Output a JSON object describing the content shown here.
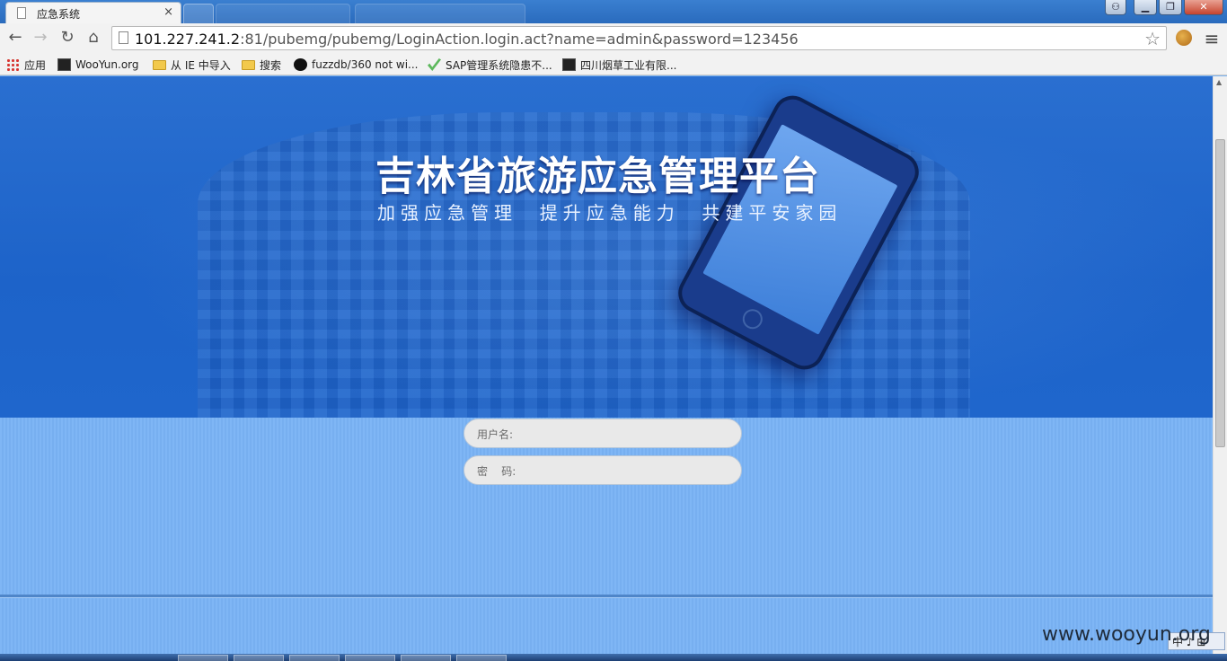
{
  "browser": {
    "active_tab": {
      "title": "应急系统",
      "close": "×"
    },
    "window_buttons": {
      "minimize": "▁",
      "maximize": "❐",
      "close": "✕"
    },
    "nav": {
      "back": "←",
      "forward": "→",
      "reload": "↻",
      "home": "⌂"
    },
    "address": {
      "host": "101.227.241.2",
      "rest": ":81/pubemg/pubemg/LoginAction.login.act?name=admin&password=123456"
    },
    "star": "☆",
    "menu": "≡",
    "bookmarks": [
      {
        "label": "应用",
        "icon": "apps-grid-icon"
      },
      {
        "label": "WooYun.org",
        "icon": "site-icon"
      },
      {
        "label": "从 IE 中导入",
        "icon": "folder-icon"
      },
      {
        "label": "搜索",
        "icon": "folder-icon"
      },
      {
        "label": "fuzzdb/360 not wi...",
        "icon": "github-icon"
      },
      {
        "label": "SAP管理系统隐患不...",
        "icon": "checkmark-icon"
      },
      {
        "label": "四川烟草工业有限...",
        "icon": "site-icon"
      }
    ]
  },
  "banner": {
    "title": "吉林省旅游应急管理平台",
    "slogan": "加强应急管理  提升应急能力  共建平安家园"
  },
  "login": {
    "username_placeholder": "用户名:",
    "password_placeholder": "密    码:"
  },
  "overlay": {
    "watermark": "www.wooyun.org",
    "ime": "中 ♪ ⊞"
  }
}
